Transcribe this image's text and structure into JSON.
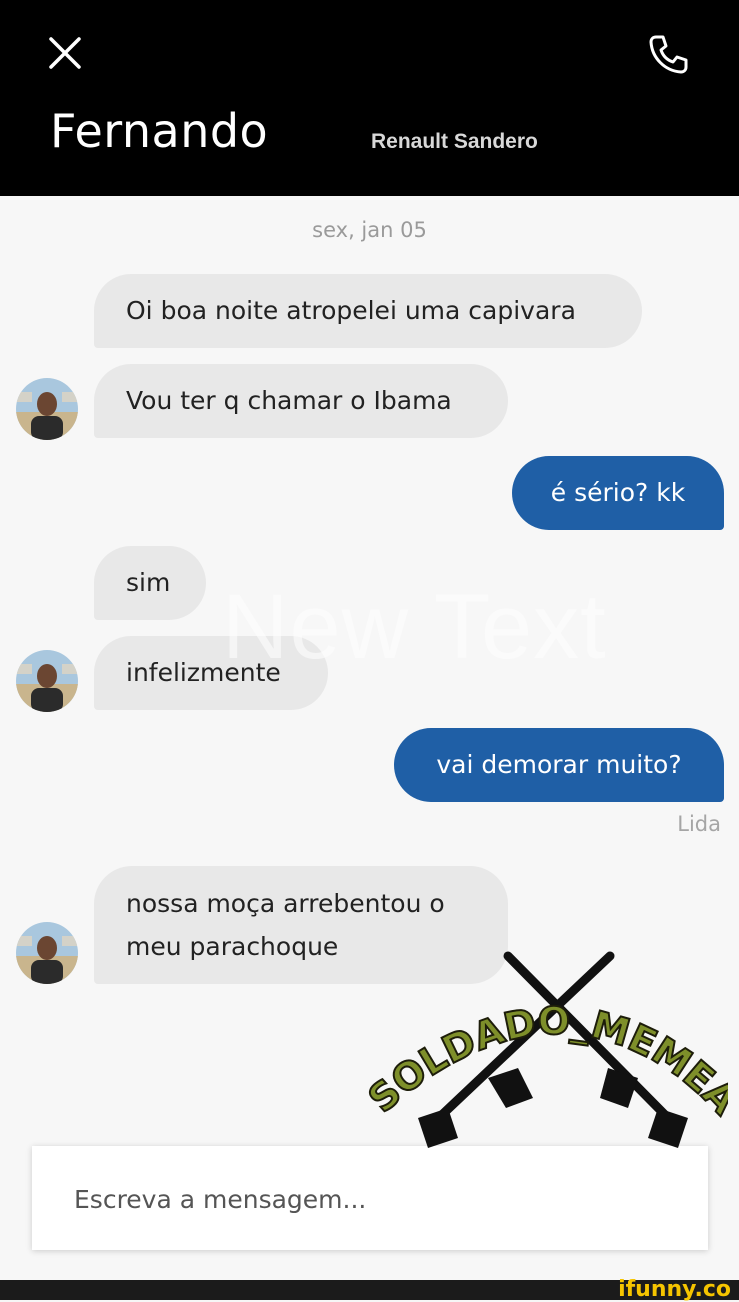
{
  "header": {
    "contact_name": "Fernando",
    "car_model": "Renault Sandero"
  },
  "chat": {
    "date_label": "sex, jan 05",
    "messages": [
      {
        "direction": "in",
        "text": "Oi boa noite atropelei uma capivara"
      },
      {
        "direction": "in",
        "text": "Vou ter q chamar o Ibama"
      },
      {
        "direction": "out",
        "text": "é sério? kk"
      },
      {
        "direction": "in",
        "text": "sim"
      },
      {
        "direction": "in",
        "text": "infelizmente"
      },
      {
        "direction": "out",
        "text": "vai demorar muito?"
      },
      {
        "direction": "in",
        "lines": [
          "nossa moça arrebentou o",
          "meu parachoque"
        ]
      }
    ],
    "read_receipt": "Lida"
  },
  "overlay_text": "New Text",
  "composer": {
    "placeholder": "Escreva a mensagem..."
  },
  "watermark_logo": "SOLDADO_MEMEAL",
  "footer_brand": "ifunny.co",
  "colors": {
    "header_bg": "#000000",
    "incoming_bubble": "#e8e8e8",
    "outgoing_bubble": "#1f5fa6",
    "chat_bg": "#f7f7f7"
  },
  "icons": [
    "close-icon",
    "phone-icon",
    "avatar"
  ]
}
